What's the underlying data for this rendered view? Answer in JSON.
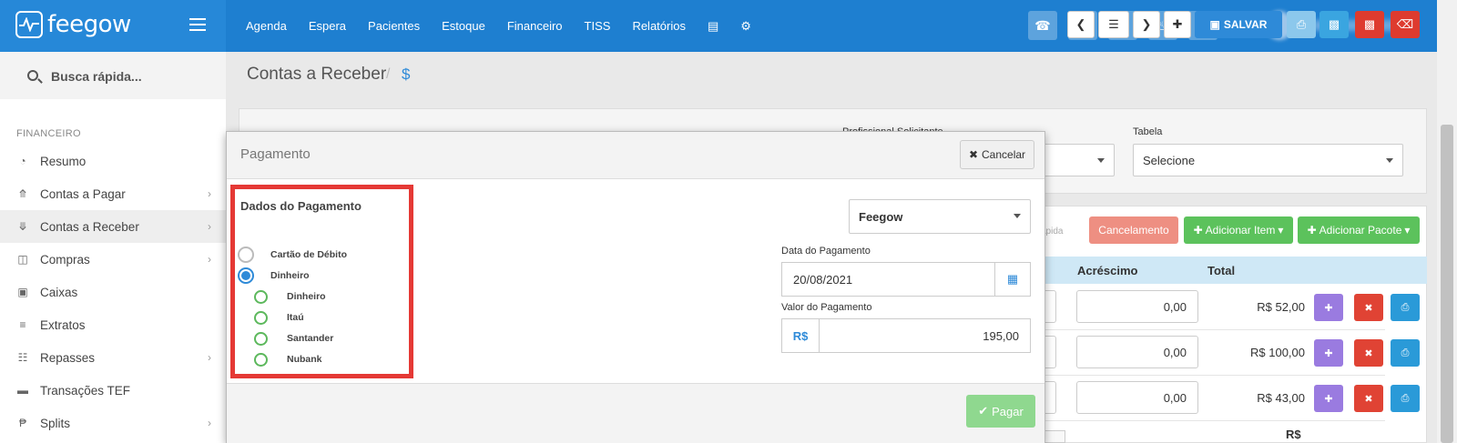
{
  "app": {
    "logo_text": "feegow"
  },
  "nav": {
    "items": [
      "Agenda",
      "Espera",
      "Pacientes",
      "Estoque",
      "Financeiro",
      "TISS",
      "Relatórios"
    ]
  },
  "sidebar": {
    "search_placeholder": "Busca rápida...",
    "section": "FINANCEIRO",
    "items": [
      {
        "label": "Resumo",
        "icon": "pie-chart-icon",
        "chevron": false
      },
      {
        "label": "Contas a Pagar",
        "icon": "arrow-up-circle-icon",
        "chevron": true
      },
      {
        "label": "Contas a Receber",
        "icon": "arrow-down-circle-icon",
        "chevron": true,
        "active": true
      },
      {
        "label": "Compras",
        "icon": "cart-icon",
        "chevron": true
      },
      {
        "label": "Caixas",
        "icon": "inbox-icon",
        "chevron": false
      },
      {
        "label": "Extratos",
        "icon": "list-icon",
        "chevron": false
      },
      {
        "label": "Repasses",
        "icon": "sitemap-icon",
        "chevron": true
      },
      {
        "label": "Transações TEF",
        "icon": "credit-card-icon",
        "chevron": false
      },
      {
        "label": "Splits",
        "icon": "split-icon",
        "chevron": true
      }
    ]
  },
  "page": {
    "title": "Contas a Receber",
    "separator": "/",
    "currency_symbol": "$",
    "save_label": "SALVAR"
  },
  "form": {
    "prof_label": "Profissional Solicitante",
    "tabela_label": "Tabela",
    "tabela_value": "Selecione"
  },
  "items_panel": {
    "rapida_label": "ápida",
    "cancel_label": "Cancelamento",
    "add_item_label": "Adicionar Item",
    "add_package_label": "Adicionar Pacote",
    "col_acrescimo": "Acréscimo",
    "col_total": "Total",
    "rows": [
      {
        "stub": "00",
        "acrescimo": "0,00",
        "total": "R$ 52,00"
      },
      {
        "stub": "00",
        "acrescimo": "0,00",
        "total": "R$ 100,00"
      },
      {
        "stub": "00",
        "acrescimo": "0,00",
        "total": "R$ 43,00"
      }
    ],
    "footer_rs": "R$"
  },
  "modal": {
    "title": "Pagamento",
    "cancel_label": "Cancelar",
    "dados_title": "Dados do Pagamento",
    "options": [
      {
        "label": "Cartão de Débito",
        "checked": false
      },
      {
        "label": "Dinheiro",
        "checked": true
      }
    ],
    "sub_options": [
      "Dinheiro",
      "Itaú",
      "Santander",
      "Nubank"
    ],
    "account_select": "Feegow",
    "date_label": "Data do Pagamento",
    "date_value": "20/08/2021",
    "value_label": "Valor do Pagamento",
    "currency": "R$",
    "value": "195,00",
    "pay_label": "Pagar"
  }
}
